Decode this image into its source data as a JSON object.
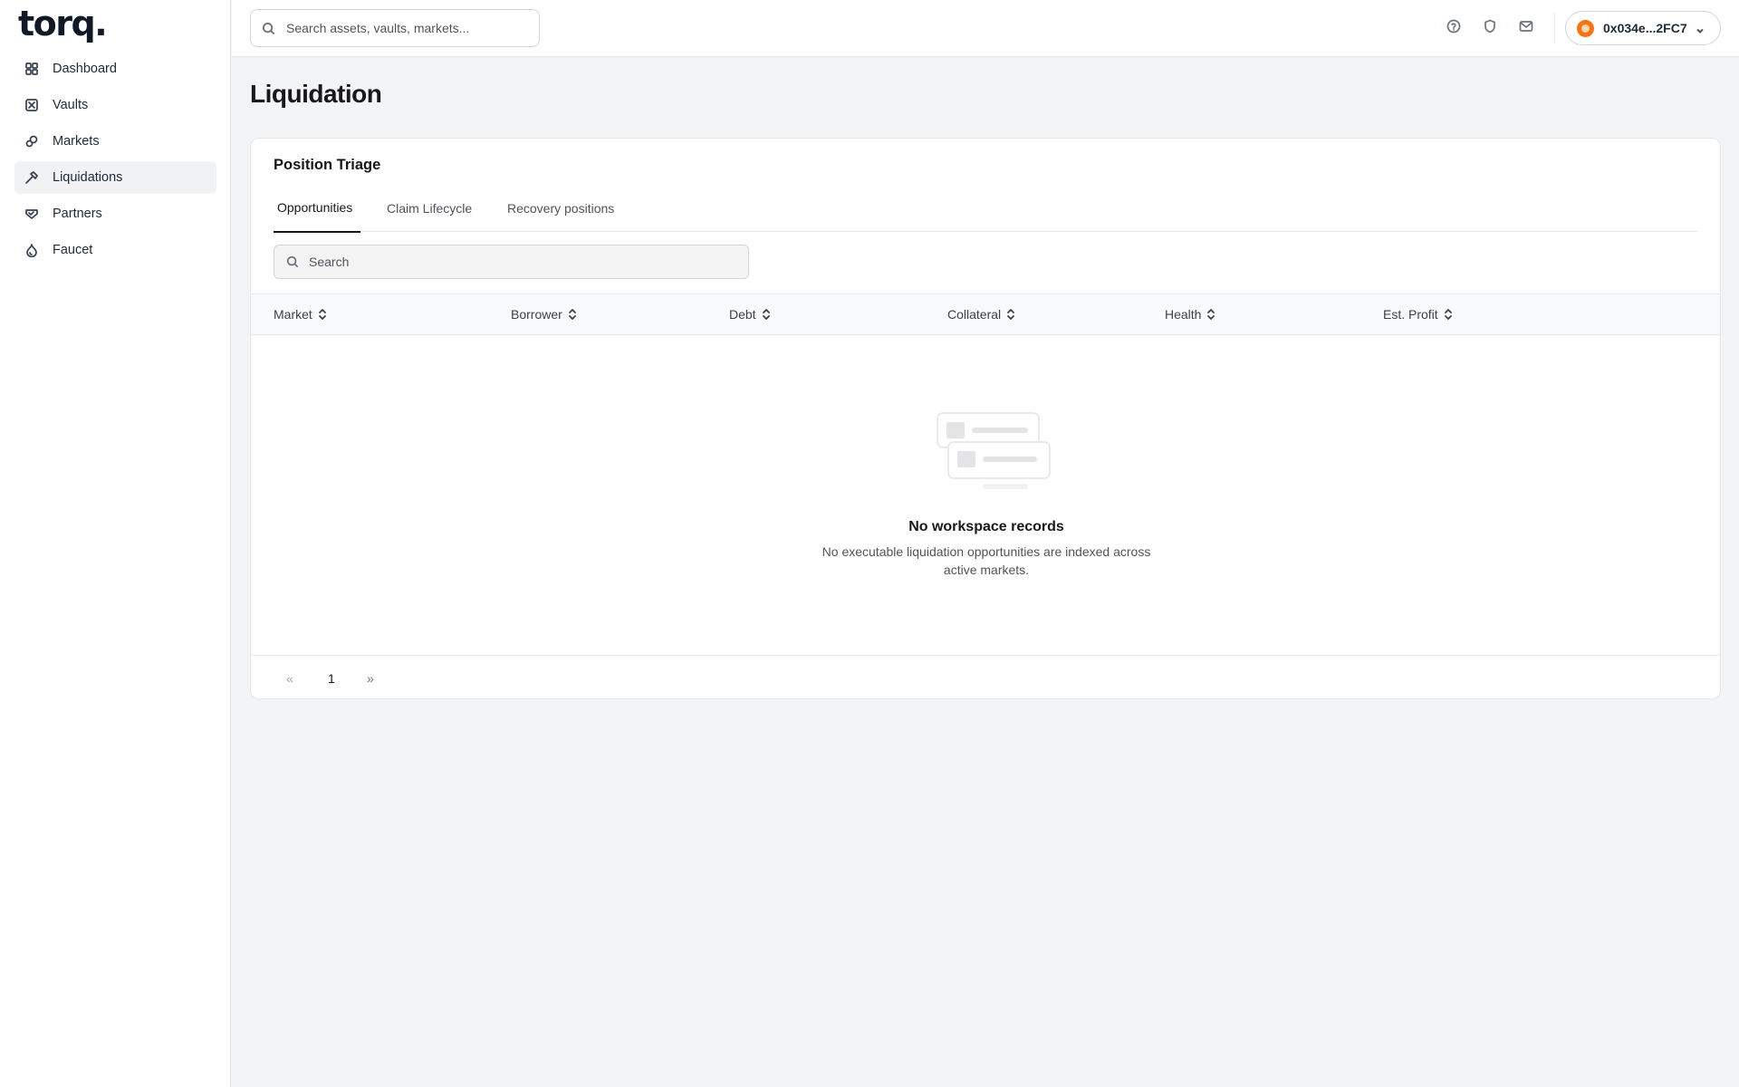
{
  "brand": {
    "name": "torq",
    "dot": "."
  },
  "sidebar": {
    "items": [
      {
        "label": "Dashboard",
        "icon": "dashboard-icon",
        "active": false
      },
      {
        "label": "Vaults",
        "icon": "vault-icon",
        "active": false
      },
      {
        "label": "Markets",
        "icon": "markets-icon",
        "active": false
      },
      {
        "label": "Liquidations",
        "icon": "hammer-icon",
        "active": true
      },
      {
        "label": "Partners",
        "icon": "handshake-icon",
        "active": false
      },
      {
        "label": "Faucet",
        "icon": "droplet-icon",
        "active": false
      }
    ]
  },
  "topbar": {
    "search_placeholder": "Search assets, vaults, markets...",
    "icons": [
      "help-icon",
      "shield-icon",
      "mail-icon"
    ],
    "wallet": {
      "address": "0x034e...2FC7",
      "avatar_color": "#f97316"
    }
  },
  "page": {
    "title": "Liquidation"
  },
  "card": {
    "title": "Position Triage",
    "tabs": [
      {
        "label": "Opportunities",
        "active": true
      },
      {
        "label": "Claim Lifecycle",
        "active": false
      },
      {
        "label": "Recovery positions",
        "active": false
      }
    ],
    "search_placeholder": "Search",
    "columns": [
      "Market",
      "Borrower",
      "Debt",
      "Collateral",
      "Health",
      "Est. Profit"
    ],
    "rows": [],
    "empty": {
      "title": "No workspace records",
      "description": "No executable liquidation opportunities are indexed across active markets."
    },
    "pagination": {
      "prev": "«",
      "current": "1",
      "next": "»"
    }
  }
}
